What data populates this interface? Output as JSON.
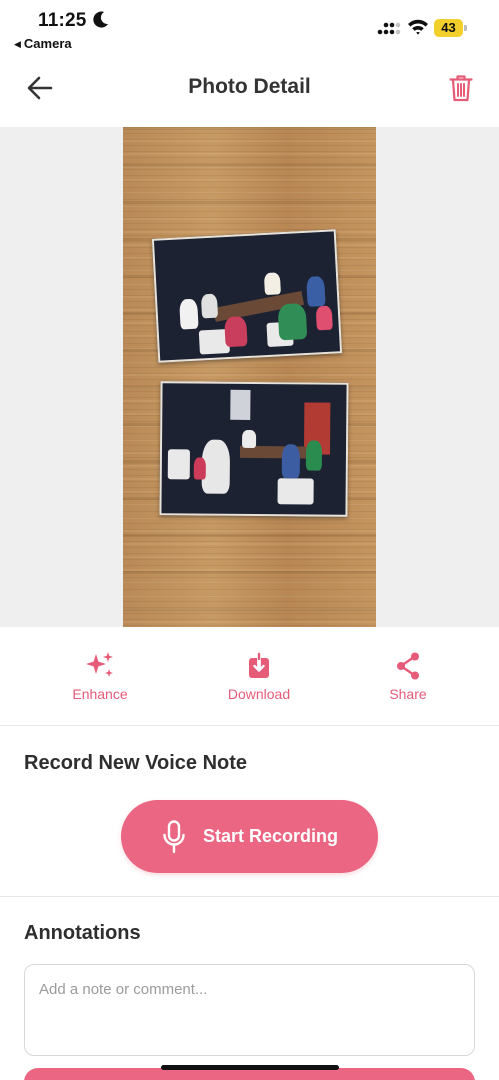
{
  "status_bar": {
    "time": "11:25",
    "back_app": "Camera",
    "battery": "43",
    "battery_color": "#f2cf2b"
  },
  "header": {
    "title": "Photo Detail",
    "back_icon": "arrow-left-icon",
    "delete_icon": "trash-icon"
  },
  "actions": [
    {
      "label": "Enhance",
      "icon": "sparkles-icon"
    },
    {
      "label": "Download",
      "icon": "download-icon"
    },
    {
      "label": "Share",
      "icon": "share-icon"
    }
  ],
  "voice_note": {
    "title": "Record New Voice Note",
    "button_label": "Start Recording",
    "button_icon": "microphone-icon"
  },
  "annotations": {
    "title": "Annotations",
    "placeholder": "Add a note or comment...",
    "value": ""
  },
  "colors": {
    "accent": "#eb6682",
    "accent_text": "#e65b78"
  }
}
